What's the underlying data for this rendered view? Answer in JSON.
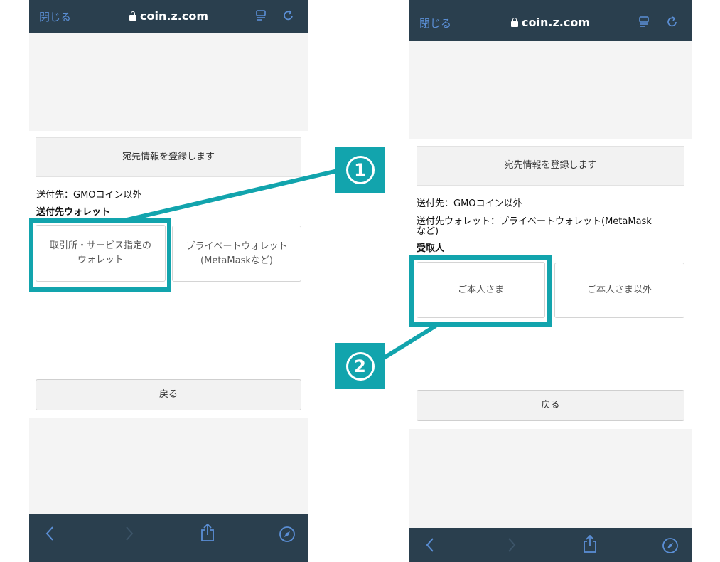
{
  "left": {
    "close_label": "閉じる",
    "url": "coin.z.com",
    "register_label": "宛先情報を登録します",
    "destination": "送付先：GMOコイン以外",
    "wallet_heading": "送付先ウォレット",
    "option1_line1": "取引所・サービス指定の",
    "option1_line2": "ウォレット",
    "option2_line1": "プライベートウォレット",
    "option2_line2": "(MetaMaskなど)",
    "back_label": "戻る"
  },
  "right": {
    "close_label": "閉じる",
    "url": "coin.z.com",
    "register_label": "宛先情報を登録します",
    "destination": "送付先：GMOコイン以外",
    "wallet_line1": "送付先ウォレット：プライベートウォレット(MetaMask",
    "wallet_line2": "など)",
    "recipient_heading": "受取人",
    "option1": "ご本人さま",
    "option2": "ご本人さま以外",
    "back_label": "戻る"
  },
  "badges": {
    "one": "1",
    "two": "2"
  },
  "icons": {
    "top": [
      "lock-icon",
      "reader-icon",
      "reload-icon"
    ],
    "bottom": [
      "back-arrow-icon",
      "forward-arrow-icon",
      "share-icon",
      "compass-icon"
    ]
  },
  "colors": {
    "accent": "#12a4ad",
    "bar": "#2a3f4e",
    "link": "#5b8fd6"
  }
}
